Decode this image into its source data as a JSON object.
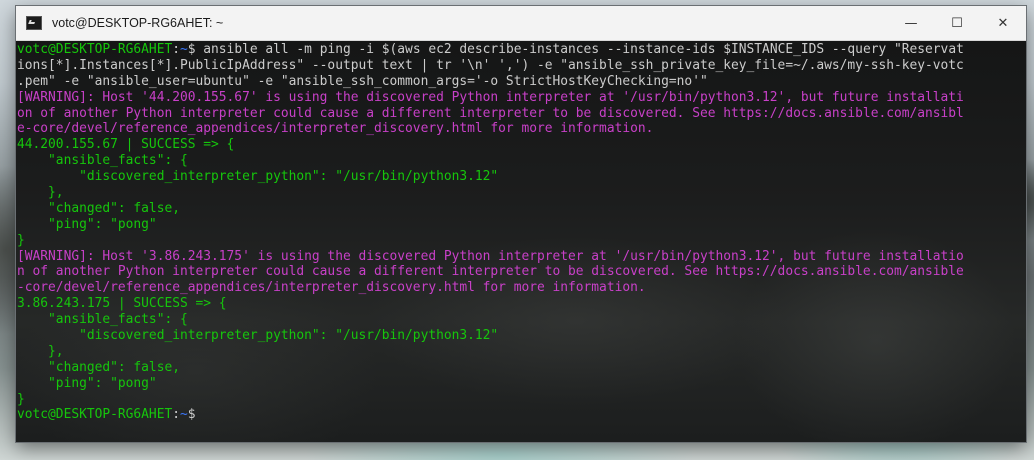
{
  "window": {
    "title": "votc@DESKTOP-RG6AHET: ~",
    "controls": {
      "minimize": "—",
      "maximize": "☐",
      "close": "✕"
    }
  },
  "terminal": {
    "prompt_user": "votc@DESKTOP-RG6AHET",
    "prompt_sep": ":",
    "prompt_path": "~",
    "prompt_end": "$",
    "command_lines": [
      " ansible all -m ping -i $(aws ec2 describe-instances --instance-ids $INSTANCE_IDS --query \"Reservat",
      "ions[*].Instances[*].PublicIpAddress\" --output text | tr '\\n' ',') -e \"ansible_ssh_private_key_file=~/.aws/my-ssh-key-votc",
      ".pem\" -e \"ansible_user=ubuntu\" -e \"ansible_ssh_common_args='-o StrictHostKeyChecking=no'\""
    ],
    "warning1": [
      "[WARNING]: Host '44.200.155.67' is using the discovered Python interpreter at '/usr/bin/python3.12', but future installati",
      "on of another Python interpreter could cause a different interpreter to be discovered. See https://docs.ansible.com/ansibl",
      "e-core/devel/reference_appendices/interpreter_discovery.html for more information."
    ],
    "result1": [
      "44.200.155.67 | SUCCESS => {",
      "    \"ansible_facts\": {",
      "        \"discovered_interpreter_python\": \"/usr/bin/python3.12\"",
      "    },",
      "    \"changed\": false,",
      "    \"ping\": \"pong\"",
      "}"
    ],
    "warning2": [
      "[WARNING]: Host '3.86.243.175' is using the discovered Python interpreter at '/usr/bin/python3.12', but future installatio",
      "n of another Python interpreter could cause a different interpreter to be discovered. See https://docs.ansible.com/ansible",
      "-core/devel/reference_appendices/interpreter_discovery.html for more information."
    ],
    "result2": [
      "3.86.243.175 | SUCCESS => {",
      "    \"ansible_facts\": {",
      "        \"discovered_interpreter_python\": \"/usr/bin/python3.12\"",
      "    },",
      "    \"changed\": false,",
      "    \"ping\": \"pong\"",
      "}"
    ]
  },
  "colors": {
    "success": "#16c60c",
    "warning": "#c840c8",
    "path": "#3b78ff",
    "text": "#cccccc",
    "titlebar": "#f3f3f3"
  }
}
